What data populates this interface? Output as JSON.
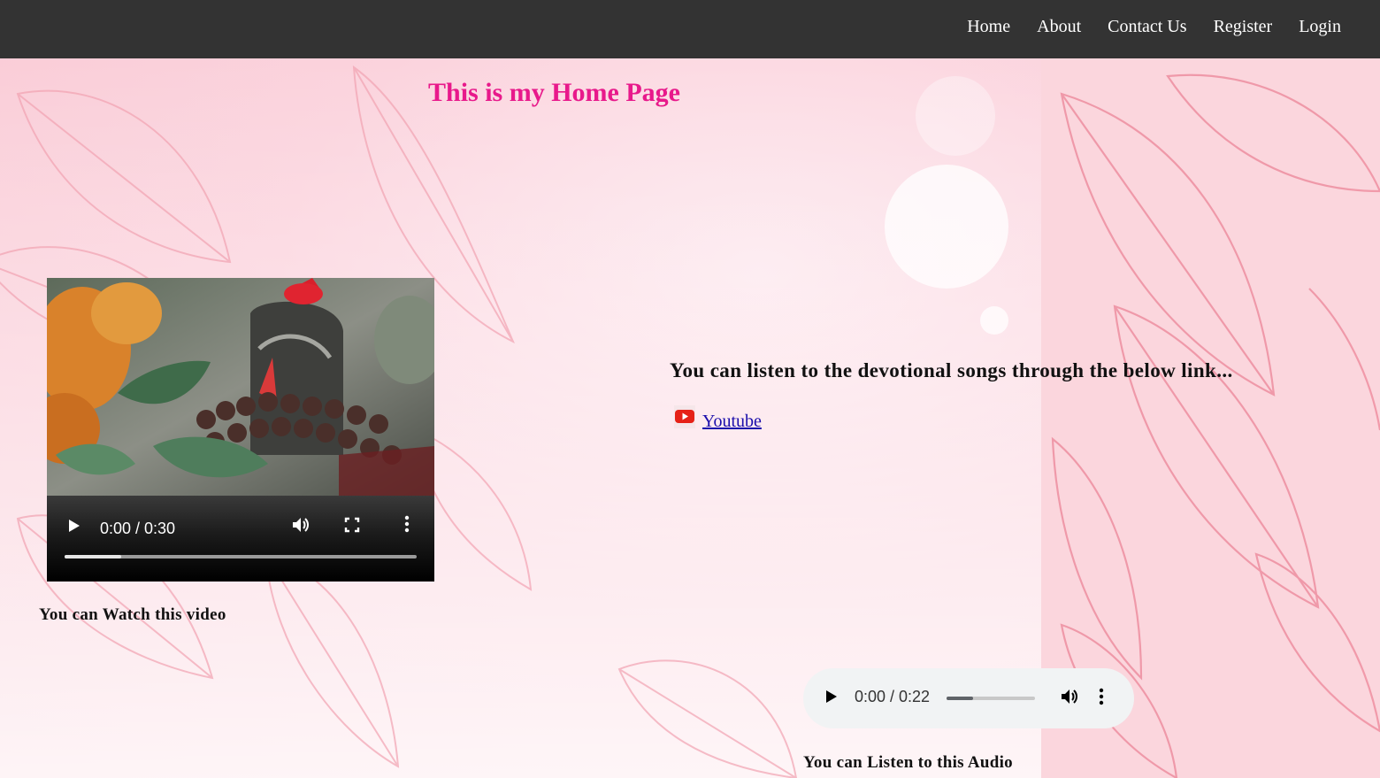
{
  "nav": {
    "items": [
      {
        "label": "Home"
      },
      {
        "label": "About"
      },
      {
        "label": "Contact Us"
      },
      {
        "label": "Register"
      },
      {
        "label": "Login"
      }
    ]
  },
  "main": {
    "title": "This is my Home Page",
    "video": {
      "time": "0:00 / 0:30",
      "progress_fraction": 0.16,
      "caption": "You can Watch this video"
    },
    "devotional_text": "You can listen to the devotional songs through the below link...",
    "youtube_link": {
      "label": " Youtube",
      "icon": "youtube-icon"
    },
    "audio": {
      "time": "0:00 / 0:22",
      "progress_fraction": 0.3,
      "caption": "You can Listen to this Audio"
    }
  },
  "colors": {
    "navbar": "#333333",
    "title": "#e8198b",
    "link": "#1a0dab"
  }
}
